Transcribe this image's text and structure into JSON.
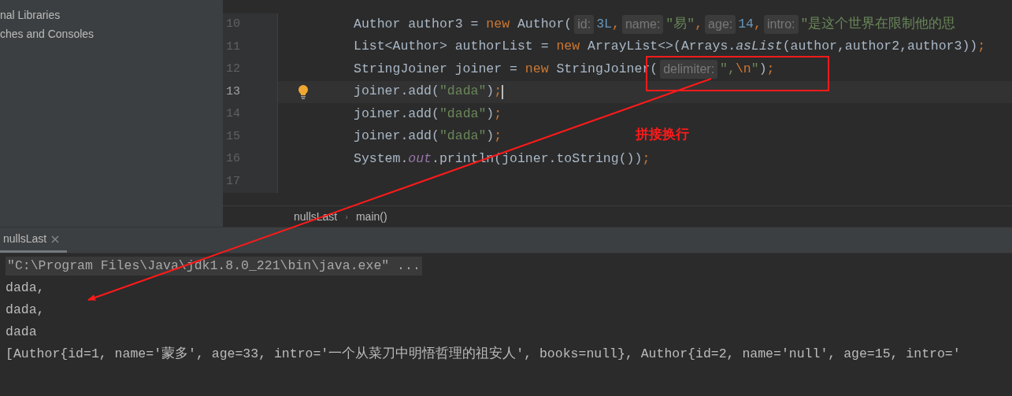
{
  "project_tree": {
    "items": [
      {
        "label": "nal Libraries"
      },
      {
        "label": "ches and Consoles"
      }
    ]
  },
  "editor": {
    "lines": [
      {
        "number": "10",
        "current": false,
        "bulb": false,
        "tokens": [
          {
            "kind": "plain",
            "text": "Author author3 = "
          },
          {
            "kind": "keyword",
            "text": "new"
          },
          {
            "kind": "plain",
            "text": " Author("
          },
          {
            "kind": "hint",
            "text": "id:"
          },
          {
            "kind": "number",
            "text": "3L"
          },
          {
            "kind": "keyword",
            "text": ","
          },
          {
            "kind": "hint",
            "text": "name:"
          },
          {
            "kind": "string",
            "text": "\"易\""
          },
          {
            "kind": "keyword",
            "text": ","
          },
          {
            "kind": "hint",
            "text": "age:"
          },
          {
            "kind": "number",
            "text": "14"
          },
          {
            "kind": "keyword",
            "text": ","
          },
          {
            "kind": "hint",
            "text": "intro:"
          },
          {
            "kind": "string",
            "text": "\"是这个世界在限制他的思"
          }
        ]
      },
      {
        "number": "11",
        "current": false,
        "bulb": false,
        "tokens": [
          {
            "kind": "plain",
            "text": "List<Author> authorList = "
          },
          {
            "kind": "keyword",
            "text": "new"
          },
          {
            "kind": "plain",
            "text": " ArrayList<>(Arrays."
          },
          {
            "kind": "method",
            "text": "asList"
          },
          {
            "kind": "plain",
            "text": "(author,author2,author3))"
          },
          {
            "kind": "keyword",
            "text": ";"
          }
        ]
      },
      {
        "number": "12",
        "current": false,
        "bulb": false,
        "tokens": [
          {
            "kind": "plain",
            "text": "StringJoiner joiner = "
          },
          {
            "kind": "keyword",
            "text": "new"
          },
          {
            "kind": "plain",
            "text": " StringJoiner("
          },
          {
            "kind": "hint",
            "text": "delimiter:"
          },
          {
            "kind": "string",
            "text": "\","
          },
          {
            "kind": "keyword",
            "text": "\\n"
          },
          {
            "kind": "string",
            "text": "\""
          },
          {
            "kind": "plain",
            "text": ")"
          },
          {
            "kind": "keyword",
            "text": ";"
          }
        ]
      },
      {
        "number": "13",
        "current": true,
        "bulb": true,
        "tokens": [
          {
            "kind": "plain",
            "text": "joiner.add("
          },
          {
            "kind": "string",
            "text": "\"dada\""
          },
          {
            "kind": "plain",
            "text": ")"
          },
          {
            "kind": "keyword",
            "text": ";"
          }
        ]
      },
      {
        "number": "14",
        "current": false,
        "bulb": false,
        "tokens": [
          {
            "kind": "plain",
            "text": "joiner.add("
          },
          {
            "kind": "string",
            "text": "\"dada\""
          },
          {
            "kind": "plain",
            "text": ")"
          },
          {
            "kind": "keyword",
            "text": ";"
          }
        ]
      },
      {
        "number": "15",
        "current": false,
        "bulb": false,
        "tokens": [
          {
            "kind": "plain",
            "text": "joiner.add("
          },
          {
            "kind": "string",
            "text": "\"dada\""
          },
          {
            "kind": "plain",
            "text": ")"
          },
          {
            "kind": "keyword",
            "text": ";"
          }
        ]
      },
      {
        "number": "16",
        "current": false,
        "bulb": false,
        "tokens": [
          {
            "kind": "plain",
            "text": "System."
          },
          {
            "kind": "field",
            "text": "out"
          },
          {
            "kind": "plain",
            "text": ".println(joiner.toString())"
          },
          {
            "kind": "keyword",
            "text": ";"
          }
        ]
      },
      {
        "number": "17",
        "current": false,
        "bulb": false
      }
    ]
  },
  "breadcrumbs": {
    "separator": "›",
    "items": [
      "nullsLast",
      "main()"
    ]
  },
  "run_tabs": [
    {
      "label": "nullsLast",
      "selected": true
    }
  ],
  "console": {
    "lines": [
      {
        "kind": "command",
        "text": "\"C:\\Program Files\\Java\\jdk1.8.0_221\\bin\\java.exe\" ..."
      },
      {
        "kind": "output",
        "text": "dada,"
      },
      {
        "kind": "output",
        "text": "dada,"
      },
      {
        "kind": "output",
        "text": "dada"
      },
      {
        "kind": "output",
        "text": "[Author{id=1, name='蒙多', age=33, intro='一个从菜刀中明悟哲理的祖安人', books=null}, Author{id=2, name='null', age=15, intro='"
      }
    ]
  },
  "annotation": {
    "label": "拼接换行"
  }
}
